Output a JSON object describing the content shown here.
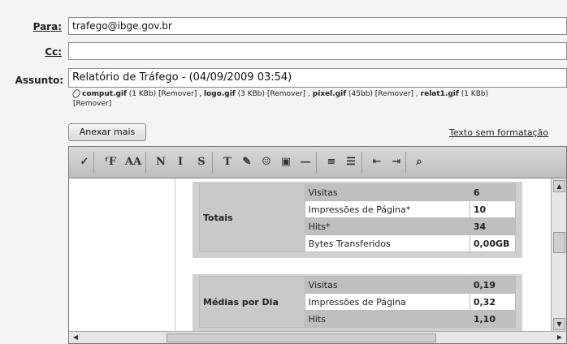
{
  "header": {
    "para_label": "Para:",
    "para_value": "trafego@ibge.gov.br",
    "cc_label": "Cc:",
    "cc_value": "",
    "assunto_label": "Assunto:",
    "assunto_value": "Relatório de Tráfego - (04/09/2009 03:54)"
  },
  "attachments": [
    {
      "name": "comput.gif",
      "size": "(1 KBb)",
      "remove": "[Remover]",
      "sep": ","
    },
    {
      "name": "logo.gif",
      "size": "(3 KBb)",
      "remove": "[Remover]",
      "sep": ","
    },
    {
      "name": "pixel.gif",
      "size": "(45bb)",
      "remove": "[Remover]",
      "sep": ","
    },
    {
      "name": "relat1.gif",
      "size": "(1 KBb)",
      "remove": "[Remover]",
      "sep": ""
    }
  ],
  "actions": {
    "anexar_label": "Anexar mais",
    "texto_label": "Texto sem formatação"
  },
  "toolbar": {
    "buttons": [
      {
        "name": "spellcheck-icon",
        "glyph": "✓"
      },
      {
        "name": "font-family-icon",
        "glyph": "ᶠF"
      },
      {
        "name": "font-size-icon",
        "glyph": "AA"
      },
      {
        "name": "bold-icon",
        "glyph": "N"
      },
      {
        "name": "italic-icon",
        "glyph": "I"
      },
      {
        "name": "underline-icon",
        "glyph": "S"
      },
      {
        "name": "text-color-icon",
        "glyph": "T"
      },
      {
        "name": "highlight-icon",
        "glyph": "✎"
      },
      {
        "name": "emoticon-icon",
        "glyph": "☺"
      },
      {
        "name": "insert-image-icon",
        "glyph": "▣"
      },
      {
        "name": "horizontal-rule-icon",
        "glyph": "—"
      },
      {
        "name": "bullet-list-icon",
        "glyph": "≡"
      },
      {
        "name": "numbered-list-icon",
        "glyph": "☰"
      },
      {
        "name": "outdent-icon",
        "glyph": "⇤"
      },
      {
        "name": "indent-icon",
        "glyph": "⇥"
      },
      {
        "name": "link-icon",
        "glyph": "⌕"
      }
    ]
  },
  "tables": [
    {
      "group": "Totais",
      "rows": [
        {
          "label": "Visitas",
          "value": "6"
        },
        {
          "label": "Impressões de Página*",
          "value": "10"
        },
        {
          "label": "Hits*",
          "value": "34"
        },
        {
          "label": "Bytes Transferidos",
          "value": "0,00GB"
        }
      ]
    },
    {
      "group": "Médias por Dia",
      "rows": [
        {
          "label": "Visitas",
          "value": "0,19"
        },
        {
          "label": "Impressões de Página",
          "value": "0,32"
        },
        {
          "label": "Hits",
          "value": "1,10"
        }
      ]
    }
  ]
}
